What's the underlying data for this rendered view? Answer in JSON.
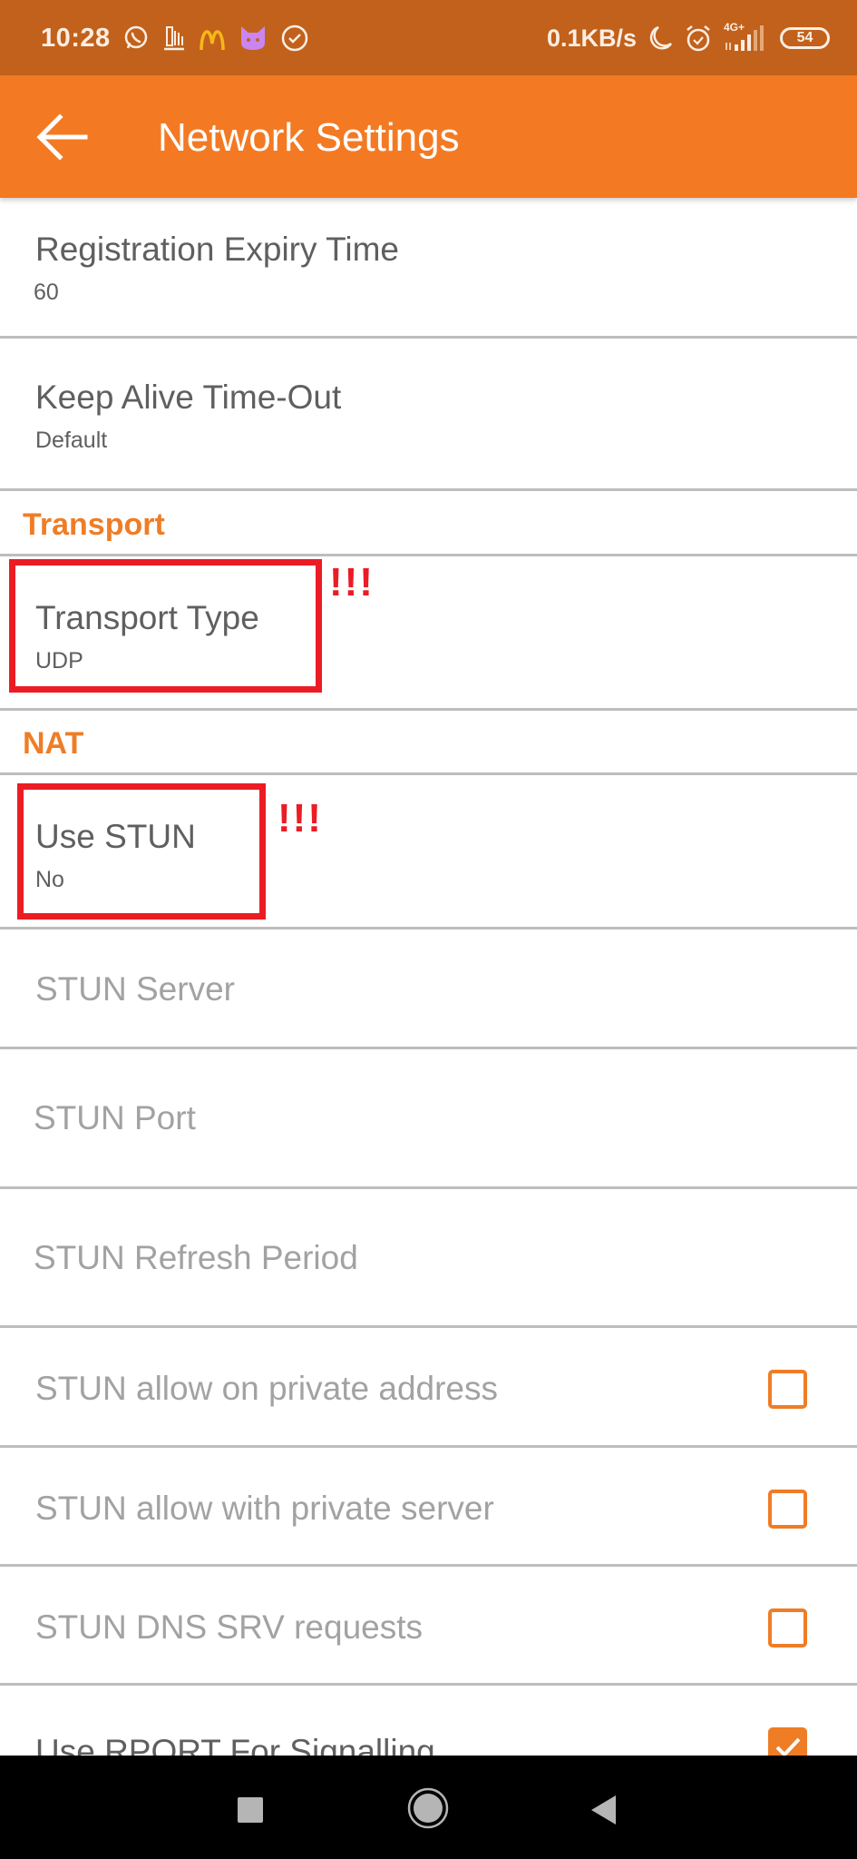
{
  "status_bar": {
    "time": "10:28",
    "left_icons": [
      "whatsapp-icon",
      "app-notification-icon",
      "mcdonalds-icon",
      "cat-app-icon",
      "check-circle-icon"
    ],
    "network_speed": "0.1KB/s",
    "right_icons": [
      "do-not-disturb-moon-icon",
      "alarm-icon",
      "signal-4g-plus-icon"
    ],
    "network_type": "4G+",
    "battery_level": "54"
  },
  "toolbar": {
    "back_icon": "arrow-left-icon",
    "title": "Network Settings",
    "background_color": "#f37a23"
  },
  "preferences": {
    "registration_expiry": {
      "title": "Registration Expiry Time",
      "summary": "60"
    },
    "keep_alive": {
      "title": "Keep Alive Time-Out",
      "summary": "Default"
    },
    "transport_category": "Transport",
    "transport_type": {
      "title": "Transport Type",
      "summary": "UDP"
    },
    "nat_category": "NAT",
    "use_stun": {
      "title": "Use STUN",
      "summary": "No"
    },
    "stun_server": {
      "title": "STUN Server",
      "enabled": false
    },
    "stun_port": {
      "title": "STUN Port",
      "enabled": false
    },
    "stun_refresh": {
      "title": "STUN Refresh Period",
      "enabled": false
    },
    "stun_allow_private_address": {
      "title": "STUN allow on private address",
      "checked": false,
      "enabled": false
    },
    "stun_allow_private_server": {
      "title": "STUN allow with private server",
      "checked": false,
      "enabled": false
    },
    "stun_dns_srv": {
      "title": "STUN DNS SRV requests",
      "checked": false,
      "enabled": false
    },
    "use_rport": {
      "title": "Use RPORT For Signalling",
      "checked": true,
      "enabled": true
    }
  },
  "annotations": {
    "transport_type_mark": "!!!",
    "use_stun_mark": "!!!",
    "highlight_color": "#ec1c24"
  },
  "accent_color": "#ef7d26",
  "nav_bar": {
    "buttons": [
      "recents-button",
      "home-button",
      "back-button"
    ]
  }
}
